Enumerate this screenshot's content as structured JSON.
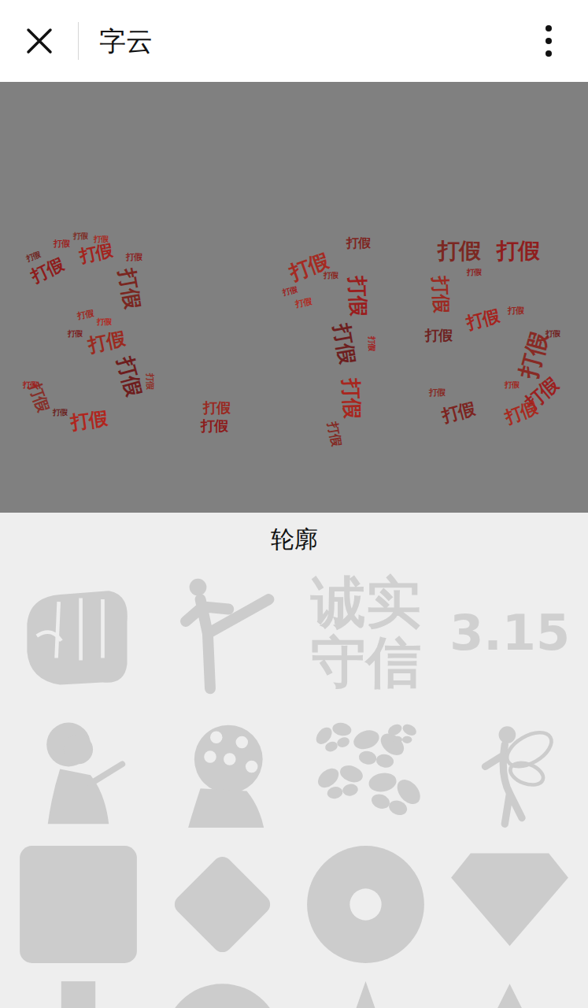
{
  "header": {
    "title": "字云"
  },
  "cloud": {
    "words": [
      {
        "text": "打假",
        "color": "#8e1b1b"
      },
      {
        "text": "打假",
        "color": "#a3231d"
      },
      {
        "text": "打假",
        "color": "#7a2620"
      },
      {
        "text": "打假",
        "color": "#9b2a1f"
      },
      {
        "text": "打假",
        "color": "#6e1d1d"
      },
      {
        "text": "打假",
        "color": "#b0261e"
      },
      {
        "text": "打假",
        "color": "#86302a"
      },
      {
        "text": "打假",
        "color": "#9c1f1f"
      },
      {
        "text": "打假",
        "color": "#7d2b24"
      },
      {
        "text": "打假",
        "color": "#a8291f"
      },
      {
        "text": "打假",
        "color": "#8a2222"
      },
      {
        "text": "打假",
        "color": "#6f2420"
      },
      {
        "text": "打假",
        "color": "#9e2720"
      },
      {
        "text": "打假",
        "color": "#b3281f"
      },
      {
        "text": "打假",
        "color": "#7a1e1e"
      },
      {
        "text": "打假",
        "color": "#8f2e26"
      },
      {
        "text": "打假",
        "color": "#a02020"
      },
      {
        "text": "打假",
        "color": "#6b2220"
      },
      {
        "text": "打假",
        "color": "#992a22"
      },
      {
        "text": "打假",
        "color": "#8c1c1c"
      },
      {
        "text": "打假",
        "color": "#a52a22"
      },
      {
        "text": "打假",
        "color": "#7e2420"
      },
      {
        "text": "打假",
        "color": "#9a1d1d"
      },
      {
        "text": "打假",
        "color": "#6d1f1f"
      },
      {
        "text": "打假",
        "color": "#a8261e"
      },
      {
        "text": "打假",
        "color": "#832a24"
      },
      {
        "text": "打假",
        "color": "#9d2222"
      },
      {
        "text": "打假",
        "color": "#b02a20"
      },
      {
        "text": "打假",
        "color": "#8a2620"
      },
      {
        "text": "打假",
        "color": "#a32020"
      },
      {
        "text": "打假",
        "color": "#7b2822"
      },
      {
        "text": "打假",
        "color": "#8f1e1e"
      },
      {
        "text": "打假",
        "color": "#9c2a22"
      },
      {
        "text": "打假",
        "color": "#6e2220"
      },
      {
        "text": "打假",
        "color": "#a5241e"
      },
      {
        "text": "打假",
        "color": "#882a24"
      },
      {
        "text": "打假",
        "color": "#9b1f1f"
      },
      {
        "text": "打假",
        "color": "#7c2420"
      },
      {
        "text": "打假",
        "color": "#a82a20"
      },
      {
        "text": "打假",
        "color": "#8d2222"
      },
      {
        "text": "打假",
        "color": "#962620"
      },
      {
        "text": "打假",
        "color": "#712020"
      },
      {
        "text": "打假",
        "color": "#a0261e"
      },
      {
        "text": "打假",
        "color": "#862a24"
      }
    ]
  },
  "outline_panel": {
    "title": "轮廓",
    "items": [
      {
        "kind": "fist"
      },
      {
        "kind": "kicker"
      },
      {
        "kind": "text",
        "lines": [
          "诚实",
          "守信"
        ]
      },
      {
        "kind": "text",
        "lines": [
          "3.15"
        ]
      },
      {
        "kind": "woman"
      },
      {
        "kind": "flower"
      },
      {
        "kind": "butterflies"
      },
      {
        "kind": "fairy"
      },
      {
        "kind": "square"
      },
      {
        "kind": "diamond"
      },
      {
        "kind": "ring"
      },
      {
        "kind": "gem"
      },
      {
        "kind": "cross"
      },
      {
        "kind": "circle"
      },
      {
        "kind": "star"
      },
      {
        "kind": "triangle"
      }
    ]
  }
}
